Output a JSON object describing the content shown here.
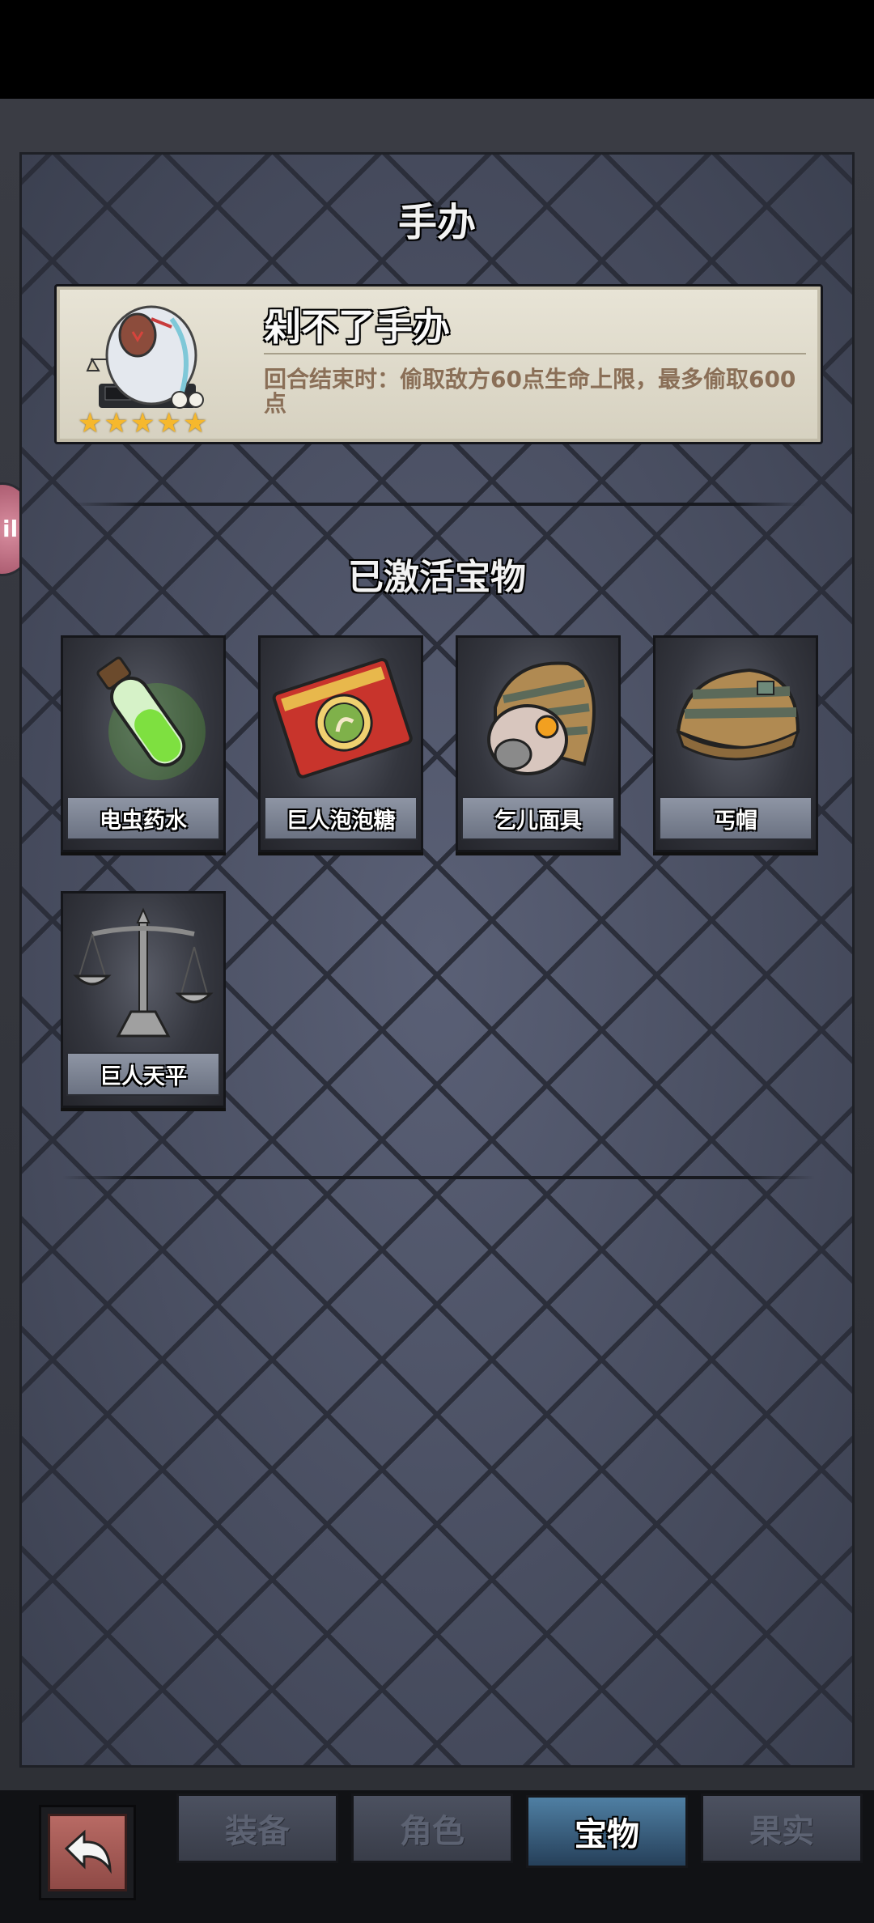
{
  "figure": {
    "section_title": "手办",
    "name": "剁不了手办",
    "description": "回合结束时：偷取敌方60点生命上限，最多偷取600点",
    "stars": 5
  },
  "treasures": {
    "section_title": "已激活宝物",
    "items": [
      {
        "label": "电虫药水",
        "icon": "green-potion-icon"
      },
      {
        "label": "巨人泡泡糖",
        "icon": "bubble-gum-pack-icon"
      },
      {
        "label": "乞儿面具",
        "icon": "beggar-mask-icon"
      },
      {
        "label": "丐帽",
        "icon": "beggar-hat-icon"
      },
      {
        "label": "巨人天平",
        "icon": "balance-scale-icon"
      }
    ]
  },
  "side_bubble": {
    "label": "ili"
  },
  "nav": {
    "back_icon": "back-arrow-icon",
    "tabs": [
      {
        "label": "装备",
        "active": false
      },
      {
        "label": "角色",
        "active": false
      },
      {
        "label": "宝物",
        "active": true
      },
      {
        "label": "果实",
        "active": false
      }
    ]
  },
  "colors": {
    "panel_bg": "#4a4f63",
    "active_tab": "#4f7fa3",
    "star": "#f6b82d",
    "description_text": "#8a6f57"
  }
}
